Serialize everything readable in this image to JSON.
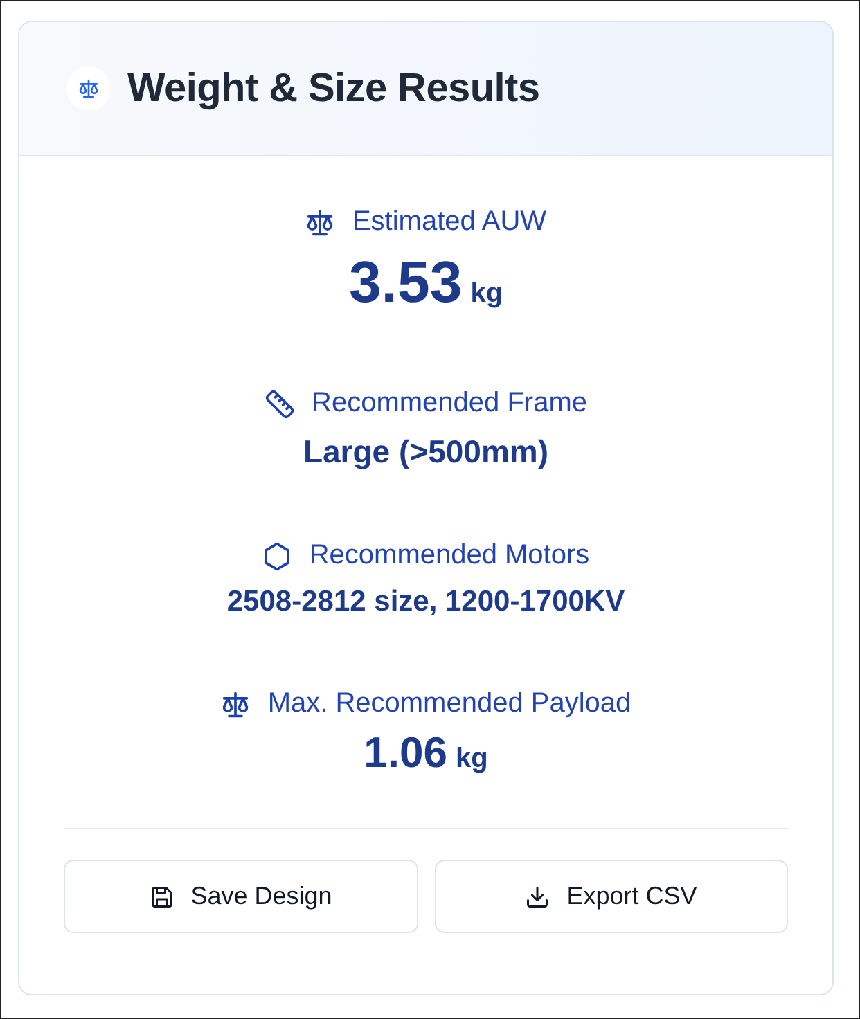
{
  "card": {
    "title": "Weight & Size Results"
  },
  "results": [
    {
      "label": "Estimated AUW",
      "value": "3.53",
      "unit": "kg",
      "kind": "weight"
    },
    {
      "label": "Recommended Frame",
      "value": "Large (>500mm)",
      "kind": "frame"
    },
    {
      "label": "Recommended Motors",
      "value": "2508-2812 size, 1200-1700KV",
      "kind": "motors"
    },
    {
      "label": "Max. Recommended Payload",
      "value": "1.06",
      "unit": "kg",
      "kind": "payload"
    }
  ],
  "buttons": [
    {
      "kind": "save",
      "label": "Save Design"
    },
    {
      "kind": "export",
      "label": "Export CSV"
    }
  ]
}
